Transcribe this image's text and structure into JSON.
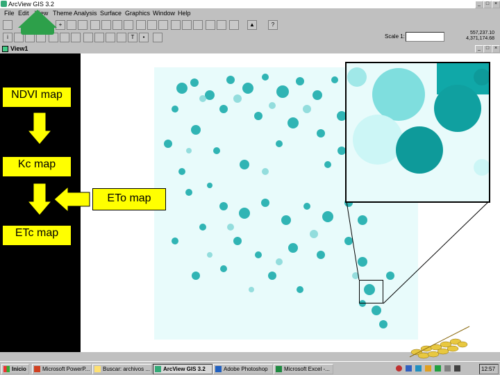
{
  "app": {
    "title": "ArcView GIS 3.2"
  },
  "menu": [
    "File",
    "Edit",
    "View",
    "Theme",
    "Analysis",
    "Surface",
    "Graphics",
    "Window",
    "Help"
  ],
  "toolbar": {
    "scale_label": "Scale 1:",
    "scale_value": "",
    "coord_x": "557,237.10",
    "coord_y": "4,371,174.68"
  },
  "view": {
    "title": "View1"
  },
  "flowchart": {
    "ndvi": "NDVI map",
    "kc": "Kc map",
    "eto": "ETo map",
    "etc": "ETc map"
  },
  "taskbar": {
    "start": "Inicio",
    "tasks": [
      "Microsoft PowerP...",
      "Buscar: archivos ...",
      "ArcView GIS 3.2",
      "Adobe Photoshop",
      "Microsoft Excel -..."
    ],
    "clock": "12:57"
  },
  "colors": {
    "crop_cyan": "#10a8a8",
    "flow_yellow": "#ffff00",
    "raster_bg": "#e8fbfb"
  }
}
